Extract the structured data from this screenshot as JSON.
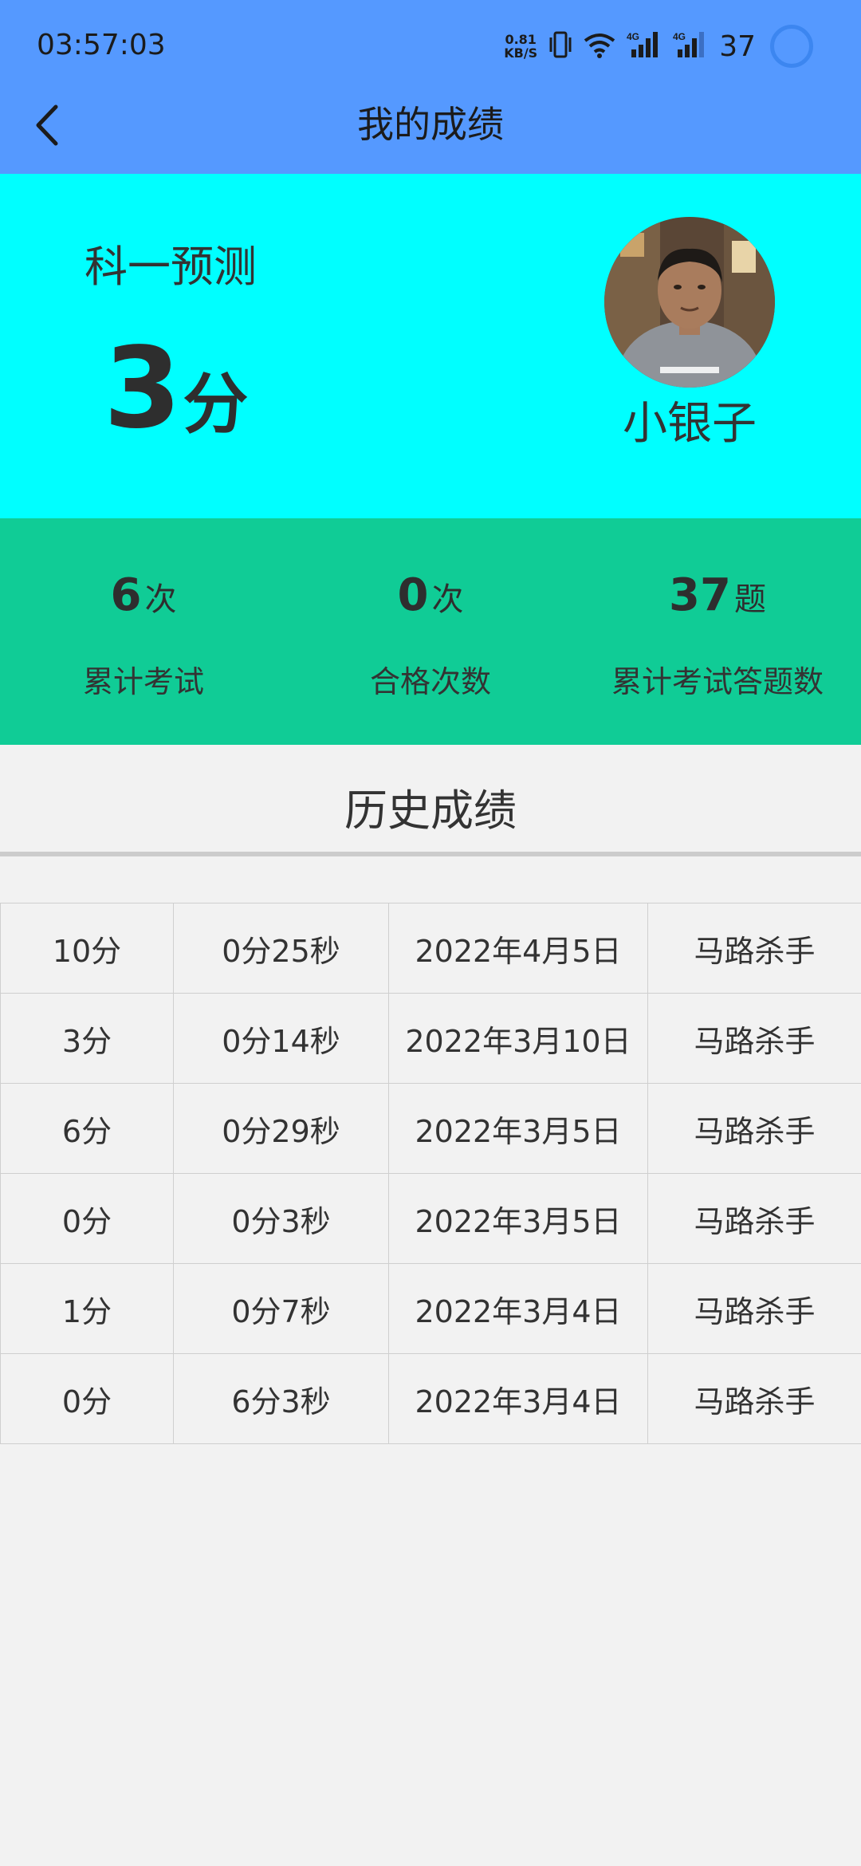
{
  "status_bar": {
    "time": "03:57:03",
    "net_speed_value": "0.81",
    "net_speed_unit": "KB/S",
    "battery": "37",
    "icons": [
      "vibrate-icon",
      "wifi-icon",
      "signal-4g-icon",
      "signal-4g-icon",
      "battery-ring-icon"
    ]
  },
  "header": {
    "title": "我的成绩",
    "back_icon": "chevron-left-icon"
  },
  "score_card": {
    "exam_name": "科一预测",
    "score": "3",
    "score_unit": "分",
    "user_name": "小银子",
    "avatar_icon": "user-avatar-photo"
  },
  "stats": [
    {
      "value": "6",
      "unit": "次",
      "label": "累计考试"
    },
    {
      "value": "0",
      "unit": "次",
      "label": "合格次数"
    },
    {
      "value": "37",
      "unit": "题",
      "label": "累计考试答题数"
    }
  ],
  "history": {
    "title": "历史成绩",
    "rows": [
      [
        "10分",
        "0分25秒",
        "2022年4月5日",
        "马路杀手"
      ],
      [
        "3分",
        "0分14秒",
        "2022年3月10日",
        "马路杀手"
      ],
      [
        "6分",
        "0分29秒",
        "2022年3月5日",
        "马路杀手"
      ],
      [
        "0分",
        "0分3秒",
        "2022年3月5日",
        "马路杀手"
      ],
      [
        "1分",
        "0分7秒",
        "2022年3月4日",
        "马路杀手"
      ],
      [
        "0分",
        "6分3秒",
        "2022年3月4日",
        "马路杀手"
      ]
    ]
  },
  "colors": {
    "app_bar": "#5599ff",
    "score_panel": "#00ffff",
    "stats_panel": "#10cc96",
    "background": "#f2f2f2",
    "text": "#333333"
  }
}
